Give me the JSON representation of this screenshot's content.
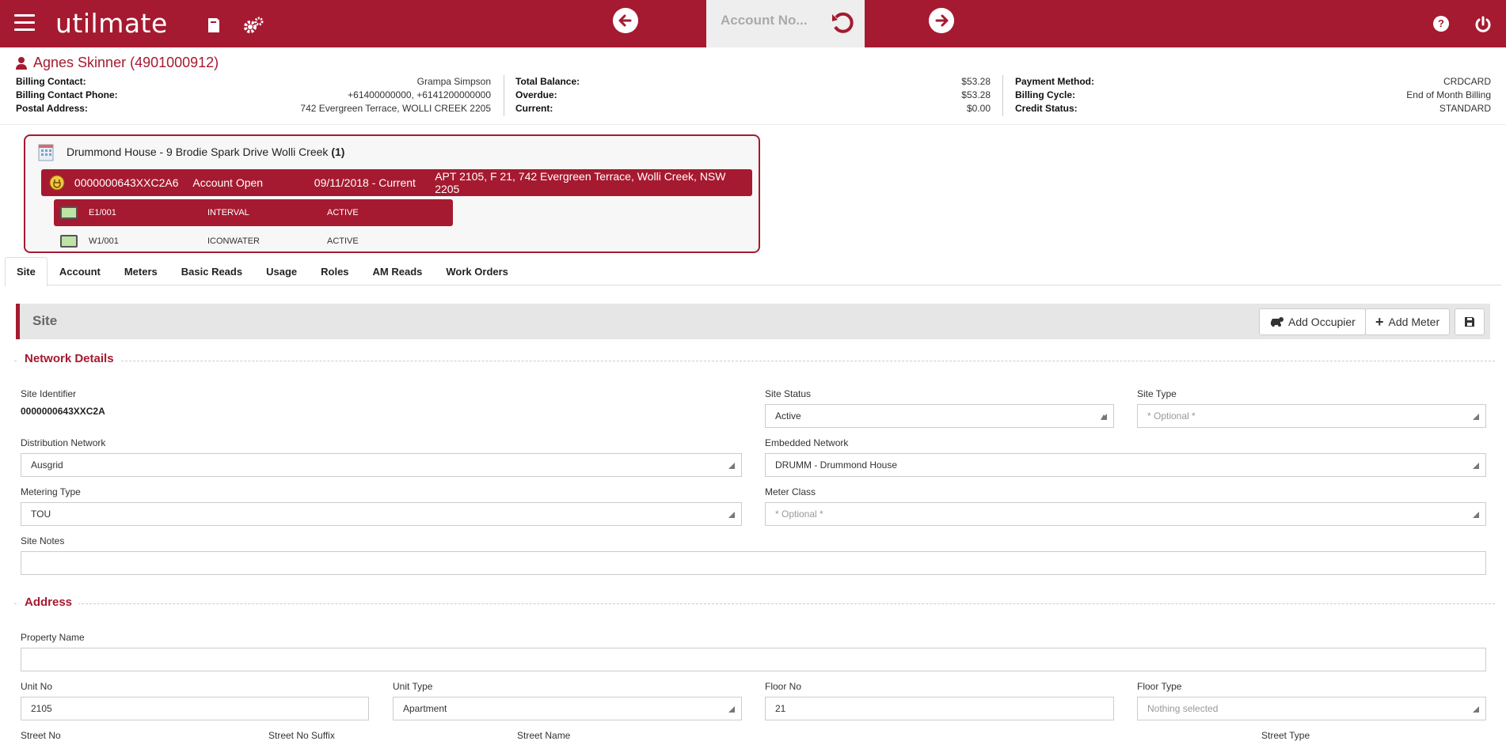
{
  "app": {
    "logo": "utilmate",
    "search_placeholder": "Account No..."
  },
  "customer": {
    "name": "Agnes Skinner (4901000912)",
    "col1": [
      {
        "label": "Billing Contact:",
        "value": "Grampa Simpson"
      },
      {
        "label": "Billing Contact Phone:",
        "value": "+61400000000, +6141200000000"
      },
      {
        "label": "Postal Address:",
        "value": "742 Evergreen Terrace, WOLLI CREEK 2205"
      }
    ],
    "col2": [
      {
        "label": "Total Balance:",
        "value": "$53.28"
      },
      {
        "label": "Overdue:",
        "value": "$53.28"
      },
      {
        "label": "Current:",
        "value": "$0.00"
      }
    ],
    "col3": [
      {
        "label": "Payment Method:",
        "value": "CRDCARD"
      },
      {
        "label": "Billing Cycle:",
        "value": "End of Month Billing"
      },
      {
        "label": "Credit Status:",
        "value": "STANDARD"
      }
    ]
  },
  "tree": {
    "site_name": "Drummond House - 9 Brodie Spark Drive Wolli Creek",
    "site_count": "(1)",
    "account": {
      "nmi": "0000000643XXC2A6",
      "status": "Account Open",
      "period": "09/11/2018 - Current",
      "address": "APT 2105, F 21, 742 Evergreen Terrace, Wolli Creek, NSW 2205"
    },
    "meters": [
      {
        "id": "E1/001",
        "type": "INTERVAL",
        "status": "ACTIVE"
      },
      {
        "id": "W1/001",
        "type": "ICONWATER",
        "status": "ACTIVE"
      }
    ]
  },
  "tabs": [
    "Site",
    "Account",
    "Meters",
    "Basic Reads",
    "Usage",
    "Roles",
    "AM Reads",
    "Work Orders"
  ],
  "panel": {
    "title": "Site",
    "add_occupier": "Add Occupier",
    "add_meter": "Add Meter"
  },
  "network": {
    "section": "Network Details",
    "site_identifier_label": "Site Identifier",
    "site_identifier": "0000000643XXC2A",
    "site_status_label": "Site Status",
    "site_status": "Active",
    "site_type_label": "Site Type",
    "site_type": "* Optional *",
    "distribution_label": "Distribution Network",
    "distribution": "Ausgrid",
    "embedded_label": "Embedded Network",
    "embedded": "DRUMM - Drummond House",
    "metering_type_label": "Metering Type",
    "metering_type": "TOU",
    "meter_class_label": "Meter Class",
    "meter_class": "* Optional *",
    "site_notes_label": "Site Notes",
    "site_notes": ""
  },
  "address": {
    "section": "Address",
    "property_name_label": "Property Name",
    "property_name": "",
    "unit_no_label": "Unit No",
    "unit_no": "2105",
    "unit_type_label": "Unit Type",
    "unit_type": "Apartment",
    "floor_no_label": "Floor No",
    "floor_no": "21",
    "floor_type_label": "Floor Type",
    "floor_type": "Nothing selected",
    "street_no_label": "Street No",
    "street_no_suffix_label": "Street No Suffix",
    "street_name_label": "Street Name",
    "street_type_label": "Street Type"
  },
  "colors": {
    "brand": "#a51a30"
  }
}
